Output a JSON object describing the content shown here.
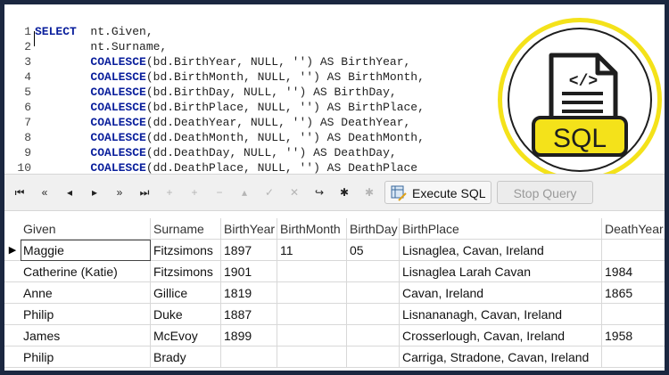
{
  "editor": {
    "lines": [
      {
        "n": "1",
        "kw": "SELECT",
        "rest": "  nt.Given,"
      },
      {
        "n": "2",
        "kw": "",
        "rest": "        nt.Surname,"
      },
      {
        "n": "3",
        "kw": "COALESCE",
        "rest": "(bd.BirthYear, NULL, '') AS BirthYear,"
      },
      {
        "n": "4",
        "kw": "COALESCE",
        "rest": "(bd.BirthMonth, NULL, '') AS BirthMonth,"
      },
      {
        "n": "5",
        "kw": "COALESCE",
        "rest": "(bd.BirthDay, NULL, '') AS BirthDay,"
      },
      {
        "n": "6",
        "kw": "COALESCE",
        "rest": "(bd.BirthPlace, NULL, '') AS BirthPlace,"
      },
      {
        "n": "7",
        "kw": "COALESCE",
        "rest": "(dd.DeathYear, NULL, '') AS DeathYear,"
      },
      {
        "n": "8",
        "kw": "COALESCE",
        "rest": "(dd.DeathMonth, NULL, '') AS DeathMonth,"
      },
      {
        "n": "9",
        "kw": "COALESCE",
        "rest": "(dd.DeathDay, NULL, '') AS DeathDay,"
      },
      {
        "n": "10",
        "kw": "COALESCE",
        "rest": "(dd.DeathPlace, NULL, '') AS DeathPlace"
      }
    ]
  },
  "badge": {
    "code_symbol": "</>",
    "label": "SQL",
    "accent": "#f4e21a",
    "doc_color": "#ffffff"
  },
  "toolbar": {
    "execute_label": "Execute SQL",
    "stop_label": "Stop Query",
    "icons": [
      "first-page-icon",
      "prev-page-icon",
      "prev-record-icon",
      "next-record-icon",
      "next-page-icon",
      "last-page-icon",
      "add-record-icon",
      "add-multiple-icon",
      "delete-record-icon",
      "move-up-icon",
      "confirm-icon",
      "cancel-icon",
      "redo-icon",
      "asterisk-icon",
      "asterisk-dim-icon"
    ]
  },
  "grid": {
    "columns": [
      "Given",
      "Surname",
      "BirthYear",
      "BirthMonth",
      "BirthDay",
      "BirthPlace",
      "DeathYear"
    ],
    "rows": [
      [
        "Maggie",
        "Fitzsimons",
        "1897",
        "11",
        "05",
        "Lisnaglea, Cavan, Ireland",
        ""
      ],
      [
        "Catherine (Katie)",
        "Fitzsimons",
        "1901",
        "",
        "",
        "Lisnaglea Larah Cavan",
        "1984"
      ],
      [
        "Anne",
        "Gillice",
        "1819",
        "",
        "",
        "Cavan, Ireland",
        "1865"
      ],
      [
        "Philip",
        "Duke",
        "1887",
        "",
        "",
        "Lisnananagh, Cavan, Ireland",
        ""
      ],
      [
        "James",
        "McEvoy",
        "1899",
        "",
        "",
        "Crosserlough, Cavan, Ireland",
        "1958"
      ],
      [
        "Philip",
        "Brady",
        "",
        "",
        "",
        "Carriga, Stradone, Cavan, Ireland",
        ""
      ]
    ],
    "current_row_marker": "▶"
  }
}
